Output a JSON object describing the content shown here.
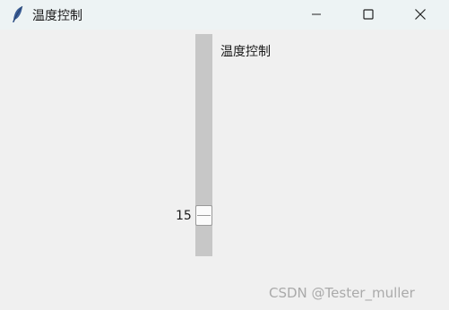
{
  "window": {
    "title": "温度控制",
    "app_icon": "feather-icon",
    "controls": {
      "minimize": "minimize-icon",
      "maximize": "maximize-icon",
      "close": "close-icon"
    }
  },
  "scale": {
    "label": "温度控制",
    "value": "15"
  },
  "watermark": {
    "text": "CSDN @Tester_muller"
  }
}
